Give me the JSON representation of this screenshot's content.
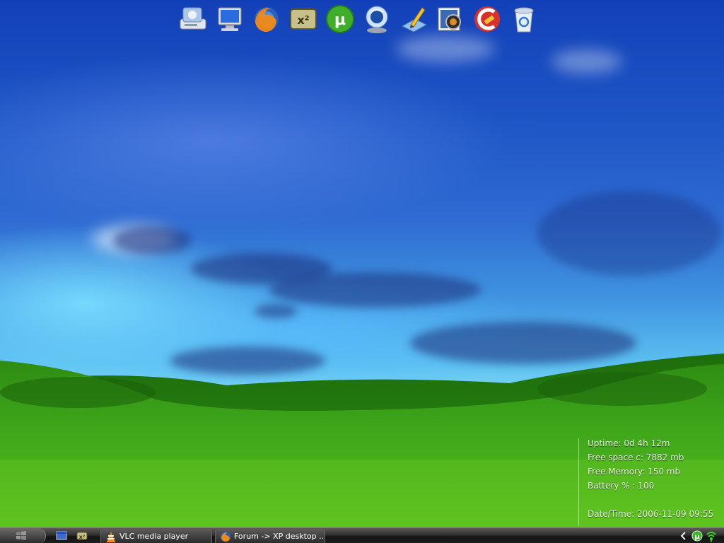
{
  "dock": {
    "icons": [
      {
        "name": "disc-drive-icon"
      },
      {
        "name": "my-computer-icon"
      },
      {
        "name": "firefox-icon"
      },
      {
        "name": "x2-app-icon"
      },
      {
        "name": "utorrent-icon"
      },
      {
        "name": "media-player-icon"
      },
      {
        "name": "pencil-notepad-icon"
      },
      {
        "name": "picture-viewer-icon"
      },
      {
        "name": "ccleaner-icon"
      },
      {
        "name": "recycle-bin-icon"
      }
    ]
  },
  "sysinfo": {
    "uptime": "Uptime: 0d 4h 12m",
    "free_space": "Free space c: 7882 mb",
    "free_memory": "Free Memory: 150 mb",
    "battery": "Battery % : 100",
    "datetime": "Date/Time: 2006-11-09 09:55"
  },
  "taskbar": {
    "tasks": [
      {
        "label": "VLC media player",
        "icon": "vlc-cone-icon"
      },
      {
        "label": "Forum -> XP desktop ...",
        "icon": "firefox-icon"
      }
    ],
    "tray_icons": [
      "chevron-left-icon",
      "utorrent-icon",
      "wireless-signal-icon"
    ]
  },
  "colors": {
    "sky_top": "#1340b8",
    "horizon": "#7fd8f6",
    "grass": "#3da51a",
    "taskbar": "#1e1e1e"
  }
}
